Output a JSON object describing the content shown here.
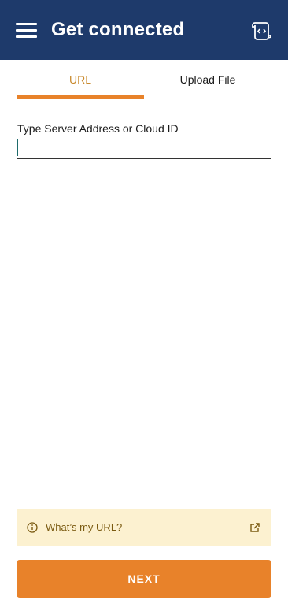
{
  "header": {
    "title": "Get connected",
    "menu_icon": "hamburger-menu-icon",
    "right_icon": "scroll-code-icon"
  },
  "tabs": [
    {
      "label": "URL",
      "selected": true
    },
    {
      "label": "Upload File",
      "selected": false
    }
  ],
  "form": {
    "label": "Type Server Address or Cloud ID",
    "value": "",
    "placeholder": ""
  },
  "help": {
    "text": "What’s my URL?",
    "left_icon": "info-icon",
    "right_icon": "external-link-icon"
  },
  "next": {
    "label": "NEXT"
  },
  "colors": {
    "header_bg": "#1e3a6b",
    "accent": "#e8822a",
    "tab_active_text": "#c98a2e",
    "help_bg": "#fcf1d0",
    "help_text": "#7a5a10"
  }
}
